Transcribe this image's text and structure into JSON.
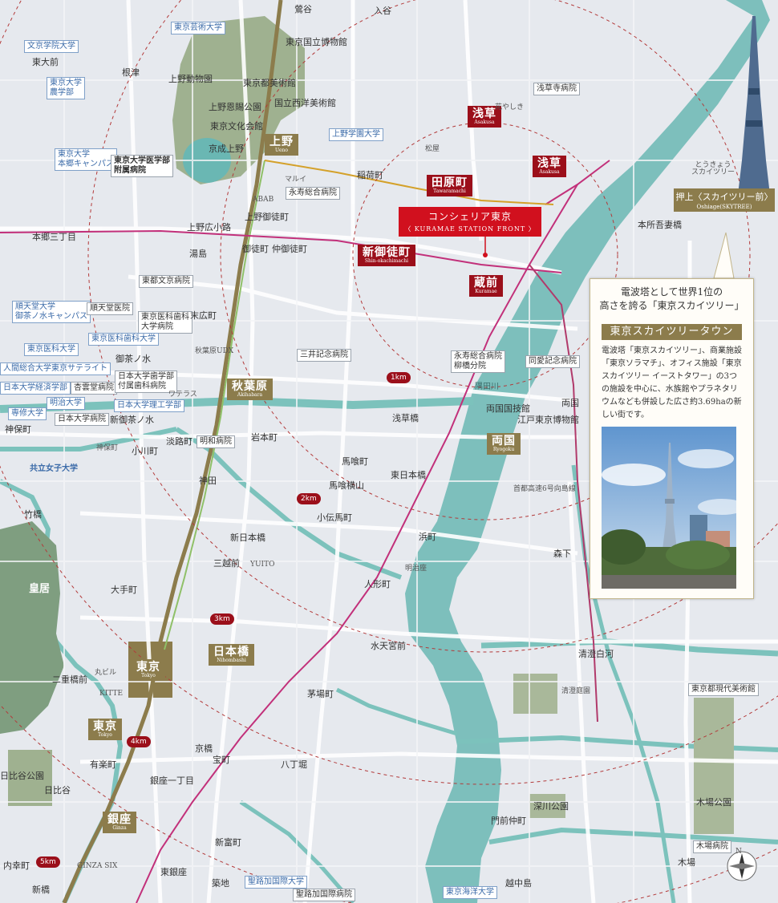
{
  "colors": {
    "background": "#e6e9ee",
    "water": "#6ab7b3",
    "park": "#9fb190",
    "accent_red": "#9b0f1a",
    "target_red": "#d1101e",
    "gold": "#8c7c4c"
  },
  "target_building": {
    "name": "コンシェリア東京",
    "sub": "〈 KURAMAE STATION FRONT 〉"
  },
  "stations": {
    "ueno": {
      "jp": "上野",
      "en": "Ueno"
    },
    "asakusa1": {
      "jp": "浅草",
      "en": "Asakusa"
    },
    "asakusa2": {
      "jp": "浅草",
      "en": "Asakusa"
    },
    "tawaramachi": {
      "jp": "田原町",
      "en": "Tawaramachi"
    },
    "shinokachimachi": {
      "jp": "新御徒町",
      "en": "Shin-okachimachi"
    },
    "kuramae": {
      "jp": "蔵前",
      "en": "Kuramae"
    },
    "akihabara": {
      "jp": "秋葉原",
      "en": "Akihabara"
    },
    "ryogoku": {
      "jp": "両国",
      "en": "Ryogoku"
    },
    "nihombashi": {
      "jp": "日本橋",
      "en": "Nihombashi"
    },
    "tokyo1": {
      "jp": "東京",
      "en": "Tokyo"
    },
    "tokyo2": {
      "jp": "東京",
      "en": "Tokyo"
    },
    "ginza": {
      "jp": "銀座",
      "en": "Ginza"
    }
  },
  "skytree_station": {
    "jp": "押上〈スカイツリー前〉",
    "en": "Oshiage(SKYTREE)"
  },
  "distances": {
    "k1": "1km",
    "k2": "2km",
    "k3": "3km",
    "k4": "4km",
    "k5": "5km"
  },
  "panel": {
    "heading_line1": "電波塔として世界1位の",
    "heading_line2": "高さを誇る「東京スカイツリー」",
    "title": "東京スカイツリータウン",
    "body": "電波塔「東京スカイツリー」、商業施設「東京ソラマチ」、オフィス施設「東京スカイツリー イーストタワー」の3つの施設を中心に、水族館やプラネタリウムなども併設した広さ約3.69haの新しい街です。"
  },
  "landmark_boxes": [
    {
      "key": "b1",
      "text": "東京芸術大学",
      "blue": true
    },
    {
      "key": "b2",
      "text": "文京学院大学",
      "blue": true
    },
    {
      "key": "b3",
      "text": "東京大学\n農学部",
      "blue": true
    },
    {
      "key": "b4",
      "text": "東京大学\n本郷キャンパス",
      "blue": true
    },
    {
      "key": "b5",
      "text": "東京大学医学部\n附属病院",
      "blue": false
    },
    {
      "key": "b6",
      "text": "上野学園大学",
      "blue": true
    },
    {
      "key": "b7",
      "text": "永寿総合病院",
      "blue": false
    },
    {
      "key": "b8",
      "text": "東都文京病院",
      "blue": false
    },
    {
      "key": "b9",
      "text": "順天堂大学\n御茶ノ水キャンパス",
      "blue": true
    },
    {
      "key": "b10",
      "text": "順天堂医院",
      "blue": false
    },
    {
      "key": "b11",
      "text": "東京医科歯科\n大学病院",
      "blue": false
    },
    {
      "key": "b12",
      "text": "東京医科歯科大学",
      "blue": true
    },
    {
      "key": "b13",
      "text": "東京医科大学",
      "blue": true
    },
    {
      "key": "b14",
      "text": "人間総合大学東京サテライト",
      "blue": true
    },
    {
      "key": "b15",
      "text": "日本大学経済学部",
      "blue": true
    },
    {
      "key": "b16",
      "text": "杏雲堂病院",
      "blue": false
    },
    {
      "key": "b17",
      "text": "明治大学",
      "blue": true
    },
    {
      "key": "b18",
      "text": "専修大学",
      "blue": true
    },
    {
      "key": "b19",
      "text": "日本大学病院",
      "blue": false
    },
    {
      "key": "b20",
      "text": "日本大学歯学部\n付属歯科病院",
      "blue": false
    },
    {
      "key": "b21",
      "text": "日本大学理工学部",
      "blue": true
    },
    {
      "key": "b22",
      "text": "三井記念病院",
      "blue": false
    },
    {
      "key": "b23",
      "text": "永寿総合病院\n柳橋分院",
      "blue": false
    },
    {
      "key": "b24",
      "text": "同愛記念病院",
      "blue": false
    },
    {
      "key": "b25",
      "text": "明和病院",
      "blue": false
    },
    {
      "key": "b26",
      "text": "浅草寺病院",
      "blue": false
    },
    {
      "key": "b27",
      "text": "東京都現代美術館",
      "blue": false
    },
    {
      "key": "b28",
      "text": "木場病院",
      "blue": false
    },
    {
      "key": "b29",
      "text": "聖路加国際大学",
      "blue": true
    },
    {
      "key": "b30",
      "text": "聖路加国際病院",
      "blue": false
    },
    {
      "key": "b31",
      "text": "東京海洋大学",
      "blue": true
    },
    {
      "key": "b32",
      "text": "共立女子大学",
      "blue": true
    }
  ],
  "labels": [
    {
      "key": "l1",
      "text": "鶯谷"
    },
    {
      "key": "l2",
      "text": "入谷"
    },
    {
      "key": "l3",
      "text": "東京国立博物館"
    },
    {
      "key": "l4",
      "text": "上野動物園"
    },
    {
      "key": "l5",
      "text": "東京都美術館"
    },
    {
      "key": "l6",
      "text": "国立西洋美術館"
    },
    {
      "key": "l7",
      "text": "上野恩賜公園"
    },
    {
      "key": "l8",
      "text": "東京文化会館"
    },
    {
      "key": "l9",
      "text": "京成上野"
    },
    {
      "key": "l10",
      "text": "根津"
    },
    {
      "key": "l11",
      "text": "東大前"
    },
    {
      "key": "l12",
      "text": "稲荷町"
    },
    {
      "key": "l13",
      "text": "上野御徒町"
    },
    {
      "key": "l14",
      "text": "上野広小路"
    },
    {
      "key": "l15",
      "text": "御徒町"
    },
    {
      "key": "l16",
      "text": "仲御徒町"
    },
    {
      "key": "l17",
      "text": "本郷三丁目"
    },
    {
      "key": "l18",
      "text": "湯島"
    },
    {
      "key": "l19",
      "text": "末広町"
    },
    {
      "key": "l20",
      "text": "御茶ノ水"
    },
    {
      "key": "l21",
      "text": "新御茶ノ水"
    },
    {
      "key": "l22",
      "text": "淡路町"
    },
    {
      "key": "l23",
      "text": "小川町"
    },
    {
      "key": "l24",
      "text": "神保町"
    },
    {
      "key": "l25",
      "text": "岩本町"
    },
    {
      "key": "l26",
      "text": "浅草橋"
    },
    {
      "key": "l27",
      "text": "両国国技館"
    },
    {
      "key": "l28",
      "text": "江戸東京博物館"
    },
    {
      "key": "l29",
      "text": "馬喰町"
    },
    {
      "key": "l30",
      "text": "馬喰横山"
    },
    {
      "key": "l31",
      "text": "東日本橋"
    },
    {
      "key": "l32",
      "text": "小伝馬町"
    },
    {
      "key": "l33",
      "text": "神田"
    },
    {
      "key": "l34",
      "text": "新日本橋"
    },
    {
      "key": "l35",
      "text": "三越前"
    },
    {
      "key": "l36",
      "text": "大手町"
    },
    {
      "key": "l37",
      "text": "人形町"
    },
    {
      "key": "l38",
      "text": "浜町"
    },
    {
      "key": "l39",
      "text": "森下"
    },
    {
      "key": "l40",
      "text": "水天宮前"
    },
    {
      "key": "l41",
      "text": "清澄白河"
    },
    {
      "key": "l42",
      "text": "茅場町"
    },
    {
      "key": "l43",
      "text": "八丁堀"
    },
    {
      "key": "l44",
      "text": "宝町"
    },
    {
      "key": "l45",
      "text": "京橋"
    },
    {
      "key": "l46",
      "text": "銀座一丁目"
    },
    {
      "key": "l47",
      "text": "有楽町"
    },
    {
      "key": "l48",
      "text": "日比谷"
    },
    {
      "key": "l49",
      "text": "新富町"
    },
    {
      "key": "l50",
      "text": "東銀座"
    },
    {
      "key": "l51",
      "text": "築地"
    },
    {
      "key": "l52",
      "text": "内幸町"
    },
    {
      "key": "l53",
      "text": "新橋"
    },
    {
      "key": "l54",
      "text": "越中島"
    },
    {
      "key": "l55",
      "text": "門前仲町"
    },
    {
      "key": "l56",
      "text": "深川公園"
    },
    {
      "key": "l57",
      "text": "木場公園"
    },
    {
      "key": "l58",
      "text": "木場"
    },
    {
      "key": "l59",
      "text": "本所吾妻橋"
    },
    {
      "key": "l60",
      "text": "とうきょう\nスカイツリー"
    },
    {
      "key": "l61",
      "text": "皇居"
    },
    {
      "key": "l62",
      "text": "二重橋前"
    },
    {
      "key": "l63",
      "text": "日比谷公園"
    },
    {
      "key": "l64",
      "text": "竹橋"
    },
    {
      "key": "l65",
      "text": "神保町"
    },
    {
      "key": "l66",
      "text": "両国"
    },
    {
      "key": "l67",
      "text": "隅田川"
    },
    {
      "key": "l68",
      "text": "清澄庭園"
    },
    {
      "key": "l69",
      "text": "ABAB"
    },
    {
      "key": "l70",
      "text": "マルイ"
    },
    {
      "key": "l71",
      "text": "KITTE"
    },
    {
      "key": "l72",
      "text": "丸ビル"
    },
    {
      "key": "l73",
      "text": "GINZA SIX"
    },
    {
      "key": "l74",
      "text": "YUITO"
    },
    {
      "key": "l75",
      "text": "花やしき"
    },
    {
      "key": "l76",
      "text": "松屋"
    },
    {
      "key": "l77",
      "text": "秋葉原UDX"
    },
    {
      "key": "l78",
      "text": "ワテラス"
    },
    {
      "key": "l79",
      "text": "明治座"
    },
    {
      "key": "l80",
      "text": "首都高速6号向島線"
    }
  ],
  "compass": {
    "n": "N"
  }
}
